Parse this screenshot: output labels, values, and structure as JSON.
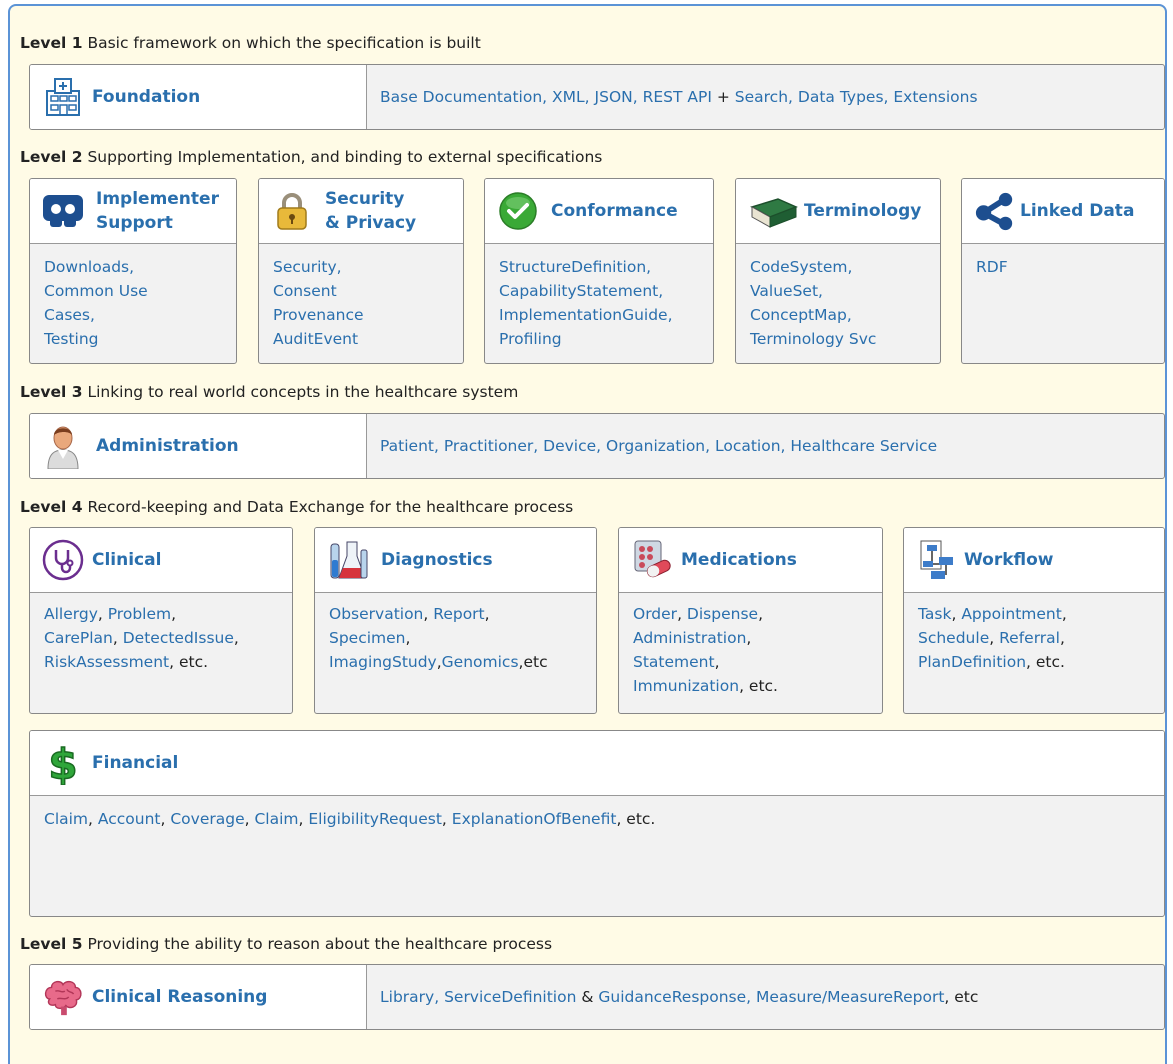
{
  "levels": [
    {
      "label": "Level 1",
      "desc": "Basic framework on which the specification is built"
    },
    {
      "label": "Level 2",
      "desc": "Supporting Implementation, and binding to external specifications"
    },
    {
      "label": "Level 3",
      "desc": "Linking to real world concepts in the healthcare system"
    },
    {
      "label": "Level 4",
      "desc": "Record-keeping and Data Exchange for the healthcare process"
    },
    {
      "label": "Level 5",
      "desc": "Providing the ability to reason about the healthcare process"
    }
  ],
  "foundation": {
    "title": "Foundation",
    "items": [
      "Base Documentation",
      ", ",
      "XML",
      ", ",
      "JSON",
      ", ",
      "REST API",
      " + ",
      "Search",
      ", ",
      "Data Types",
      ", ",
      "Extensions"
    ]
  },
  "implementer": {
    "title_1": "Implementer",
    "title_2": "Support",
    "lines": [
      "Downloads,",
      "Common Use",
      "Cases,",
      "Testing"
    ]
  },
  "security": {
    "title_1": "Security",
    "title_2": "& Privacy",
    "lines": [
      "Security,",
      "Consent",
      "Provenance",
      "AuditEvent"
    ]
  },
  "conformance": {
    "title": "Conformance",
    "lines": [
      "StructureDefinition,",
      "CapabilityStatement,",
      "ImplementationGuide,",
      "Profiling"
    ]
  },
  "terminology": {
    "title": "Terminology",
    "lines": [
      "CodeSystem,",
      "ValueSet,",
      "ConceptMap,",
      "Terminology Svc"
    ]
  },
  "linked": {
    "title": "Linked Data",
    "lines": [
      "RDF"
    ]
  },
  "administration": {
    "title": "Administration",
    "items": [
      "Patient",
      ", ",
      "Practitioner",
      ", ",
      "Device",
      ", ",
      "Organization",
      ", ",
      "Location",
      ", ",
      "Healthcare Service"
    ]
  },
  "clinical": {
    "title": "Clinical",
    "l1a": "Allergy",
    "l1b": ", ",
    "l1c": "Problem",
    "l1d": ",",
    "l2a": "CarePlan",
    "l2b": ", ",
    "l2c": "DetectedIssue",
    "l2d": ",",
    "l3a": "RiskAssessment",
    "l3b": ", etc."
  },
  "diagnostics": {
    "title": "Diagnostics",
    "l1a": "Observation",
    "l1b": ", ",
    "l1c": "Report",
    "l1d": ",",
    "l2a": "Specimen",
    "l2b": ",",
    "l3a": "ImagingStudy",
    "l3b": ",",
    "l3c": "Genomics",
    "l3d": ",etc"
  },
  "medications": {
    "title": "Medications",
    "l1a": "Order",
    "l1b": ", ",
    "l1c": "Dispense",
    "l1d": ",",
    "l2a": "Administration",
    "l2b": ",",
    "l3a": "Statement",
    "l3b": ",",
    "l4a": "Immunization",
    "l4b": ", etc."
  },
  "workflow": {
    "title": "Workflow",
    "l1a": "Task",
    "l1b": ", ",
    "l1c": "Appointment",
    "l1d": ",",
    "l2a": "Schedule",
    "l2b": ", ",
    "l2c": "Referral",
    "l2d": ",",
    "l3a": "PlanDefinition",
    "l3b": ", etc."
  },
  "financial": {
    "title": "Financial",
    "items": [
      "Claim",
      ", ",
      "Account",
      ", ",
      "Coverage",
      ", ",
      "Claim",
      ", ",
      "EligibilityRequest",
      ", ",
      "ExplanationOfBenefit",
      ", etc."
    ]
  },
  "reasoning": {
    "title": "Clinical Reasoning",
    "items": [
      "Library",
      ", ",
      "ServiceDefinition",
      " & ",
      "GuidanceResponse",
      ", ",
      "Measure",
      "/",
      "MeasureReport",
      ", etc"
    ]
  },
  "colors": {
    "link": "#2a6fad",
    "frame": "#5b93d6",
    "background": "#fffbe6",
    "box": "#f2f2f2"
  }
}
